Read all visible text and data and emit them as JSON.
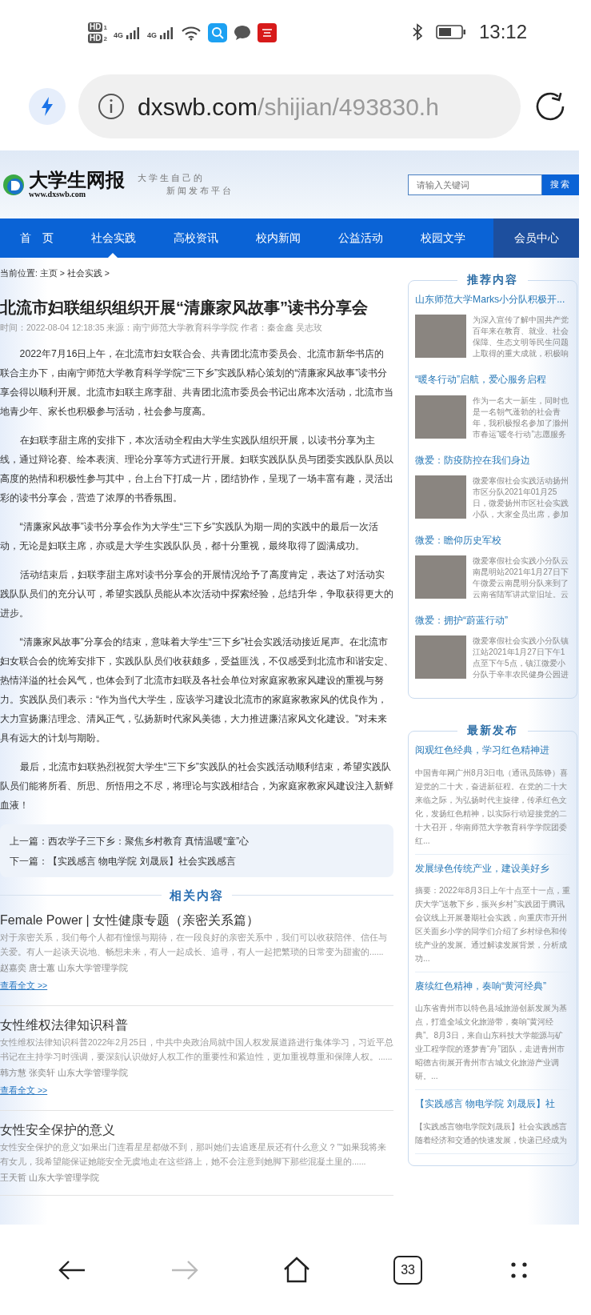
{
  "status_bar": {
    "sim_labels": [
      "HD",
      "HD"
    ],
    "sim_numbers": [
      "1",
      "2"
    ],
    "network": [
      "4G",
      "4G"
    ],
    "time": "13:12"
  },
  "browser": {
    "url_domain": "dxswb.com",
    "url_path": "/shijian/493830.h"
  },
  "site_header": {
    "logo_title": "大学生网报",
    "logo_url": "www.dxswb.com",
    "slogan": [
      "大学生自己的",
      "新闻发布平台"
    ],
    "search": {
      "placeholder": "请输入关键词",
      "button": "搜索"
    }
  },
  "nav": {
    "items": [
      {
        "label": "首　页",
        "selected": false
      },
      {
        "label": "社会实践",
        "selected": true
      },
      {
        "label": "高校资讯",
        "selected": false
      },
      {
        "label": "校内新闻",
        "selected": false
      },
      {
        "label": "公益活动",
        "selected": false
      },
      {
        "label": "校园文学",
        "selected": false
      }
    ],
    "member": "会员中心"
  },
  "breadcrumb": "当前位置: 主页 > 社会实践 >",
  "article": {
    "title": "北流市妇联组织组织开展“清廉家风故事”读书分享会",
    "meta": "时间：2022-08-04 12:18:35 来源：南宁师范大学教育科学学院 作者：秦金鑫 吴志玫",
    "paragraphs": [
      "2022年7月16日上午，在北流市妇女联合会、共青团北流市委员会、北流市新华书店的联合主办下，由南宁师范大学教育科学学院“三下乡”实践队精心策划的“清廉家风故事”读书分享会得以顺利开展。北流市妇联主席李甜、共青团北流市委员会书记出席本次活动，北流市当地青少年、家长也积极参与活动，社会参与度高。",
      "在妇联李甜主席的安排下，本次活动全程由大学生实践队组织开展，以读书分享为主线，通过辩论赛、绘本表演、理论分享等方式进行开展。妇联实践队队员与团委实践队队员以高度的热情和积极性参与其中，台上台下打成一片，团结协作，呈现了一场丰富有趣，灵活出彩的读书分享会，营造了浓厚的书香氛围。",
      "“清廉家风故事”读书分享会作为大学生“三下乡”实践队为期一周的实践中的最后一次活动，无论是妇联主席，亦或是大学生实践队队员，都十分重视，最终取得了圆满成功。",
      "活动结束后，妇联李甜主席对读书分享会的开展情况给予了高度肯定，表达了对活动实践队队员们的充分认可，希望实践队员能从本次活动中探索经验，总结升华，争取获得更大的进步。",
      "“清廉家风故事”分享会的结束，意味着大学生“三下乡”社会实践活动接近尾声。在北流市妇女联合会的统筹安排下，实践队队员们收获颇多，受益匪浅，不仅感受到北流市和谐安定、热情洋溢的社会风气，也体会到了北流市妇联及各社会单位对家庭家教家风建设的重视与努力。实践队员们表示：“作为当代大学生，应该学习建设北流市的家庭家教家风的优良作为，大力宣扬廉洁理念、清风正气，弘扬新时代家风美德，大力推进廉洁家风文化建设。”对未来具有远大的计划与期盼。",
      "最后，北流市妇联热烈祝贺大学生“三下乡”实践队的社会实践活动顺利结束，希望实践队队员们能将所看、所思、所悟用之不尽，将理论与实践相结合，为家庭家教家风建设注入新鲜血液！"
    ],
    "prev": "上一篇：西农学子三下乡：聚焦乡村教育 真情温暖“童”心",
    "next": "下一篇：【实践感言 物电学院 刘晟辰】社会实践感言"
  },
  "related": {
    "heading": "相关内容",
    "items": [
      {
        "title": "Female Power | 女性健康专题（亲密关系篇）",
        "summary": "对于亲密关系，我们每个人都有憧憬与期待，在一段良好的亲密关系中，我们可以收获陪伴、信任与关爱。有人一起谈天说地、畅想未来，有人一起成长、追寻，有人一起把繁琐的日常变为甜蜜的......",
        "authors": "赵嘉奕 唐士蕙 山东大学管理学院",
        "link": "查看全文 >>"
      },
      {
        "title": "女性维权法律知识科普",
        "summary": "女性维权法律知识科普2022年2月25日，中共中央政治局就中国人权发展道路进行集体学习，习近平总书记在主持学习时强调，要深刻认识做好人权工作的重要性和紧迫性，更加重视尊重和保障人权。......",
        "authors": "韩方慧 张奕轩 山东大学管理学院",
        "link": "查看全文 >>"
      },
      {
        "title": "女性安全保护的意义",
        "summary": "女性安全保护的意义“如果出门连看星星都做不到，那叫她们去追逐星辰还有什么意义？”“如果我将来有女儿，我希望能保证她能安全无虞地走在这些路上，她不会注意到她脚下那些混凝土里的......",
        "authors": "王天哲 山东大学管理学院"
      }
    ]
  },
  "recommended": {
    "heading": "推荐内容",
    "items": [
      {
        "title": "山东师范大学Marks小分队积极开...",
        "snippet": "为深入宣传了解中国共产党百年来在教育、就业、社会保障、生态文明等民生问题上取得的重大成就，积极响"
      },
      {
        "title": "“暖冬行动”启航，爱心服务启程",
        "snippet": "作为一名大一新生，同时也是一名朝气蓬勃的社会青年，我积极报名参加了滁州市春运“暖冬行动”志愿服务"
      },
      {
        "title": "微爱：防疫防控在我们身边",
        "snippet": "微爱寒假社会实践活动扬州市区分队2021年01月25日，微爱扬州市区社会实践小队，大家全员出席，参加"
      },
      {
        "title": "微爱：瞻仰历史军校",
        "snippet": "微爱寒假社会实践小分队云南昆明站2021年1月27日下午微爱云南昆明分队来到了云南省陆军讲武堂旧址。云"
      },
      {
        "title": "微爱：拥护“蔚蓝行动”",
        "snippet": "微爱寒假社会实践小分队镇江站2021年1月27日下午1点至下午5点，镇江微爱小分队于辛丰农民健身公园进"
      }
    ]
  },
  "latest": {
    "heading": "最新发布",
    "items": [
      {
        "title": "阅观红色经典，学习红色精神进",
        "summary": "中国青年网广州8月3日电（通讯员陈铮）喜迎党的二十大，奋进新征程。在党的二十大来临之际，为弘扬时代主旋律，传承红色文化，发扬红色精神，以实际行动迎接党的二十大召开，华南师范大学教育科学学院团委红..."
      },
      {
        "title": "发展绿色传统产业，建设美好乡",
        "summary": "摘要：2022年8月3日上午十点至十一点，重庆大学“送教下乡，振兴乡村”实践团于腾讯会议线上开展暑期社会实践，向重庆市开州区关面乡小学的同学们介绍了乡村绿色和传统产业的发展。通过解读发展背景，分析成功..."
      },
      {
        "title": "赓续红色精神，奏响“黄河经典”",
        "summary": "山东省青州市以特色县域旅游创新发展为基点，打造全域文化旅游带，奏响“黄河经典”。8月3日，来自山东科技大学能源与矿业工程学院的逐梦青“舟”团队，走进青州市昭德古街展开青州市古城文化旅游产业调研。..."
      },
      {
        "title": "【实践感言 物电学院 刘晟辰】社",
        "summary": "【实践感言物电学院刘晟辰】社会实践感言随着经济和交通的快速发展，快递已经成为"
      }
    ]
  },
  "bottom_bar": {
    "buttons": [
      {
        "kind": "back",
        "disabled": false
      },
      {
        "kind": "forward",
        "disabled": true
      },
      {
        "kind": "home",
        "disabled": false
      },
      {
        "kind": "tabs",
        "disabled": false,
        "count": "33"
      },
      {
        "kind": "menu",
        "disabled": false
      }
    ]
  }
}
